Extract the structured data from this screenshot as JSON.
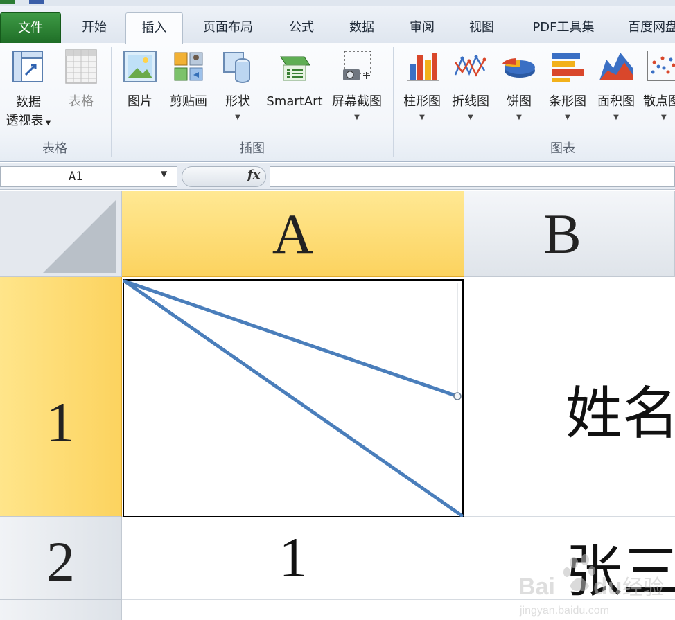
{
  "ribbon_tabs": [
    {
      "label": "文件"
    },
    {
      "label": "开始"
    },
    {
      "label": "插入"
    },
    {
      "label": "页面布局"
    },
    {
      "label": "公式"
    },
    {
      "label": "数据"
    },
    {
      "label": "审阅"
    },
    {
      "label": "视图"
    },
    {
      "label": "PDF工具集"
    },
    {
      "label": "百度网盘"
    }
  ],
  "active_tab": "插入",
  "groups": {
    "tables": {
      "label": "表格",
      "buttons": [
        {
          "label_line1": "数据",
          "label_line2": "透视表",
          "icon": "pivot-table-icon"
        },
        {
          "label": "表格",
          "icon": "table-icon",
          "disabled": true
        }
      ]
    },
    "illustrations": {
      "label": "插图",
      "buttons": [
        {
          "label": "图片",
          "icon": "picture-icon"
        },
        {
          "label": "剪贴画",
          "icon": "clipart-icon"
        },
        {
          "label": "形状",
          "icon": "shapes-icon"
        },
        {
          "label": "SmartArt",
          "icon": "smartart-icon"
        },
        {
          "label": "屏幕截图",
          "icon": "screenshot-icon"
        }
      ]
    },
    "charts": {
      "label": "图表",
      "buttons": [
        {
          "label": "柱形图",
          "icon": "column-chart-icon"
        },
        {
          "label": "折线图",
          "icon": "line-chart-icon"
        },
        {
          "label": "饼图",
          "icon": "pie-chart-icon"
        },
        {
          "label": "条形图",
          "icon": "bar-chart-icon"
        },
        {
          "label": "面积图",
          "icon": "area-chart-icon"
        },
        {
          "label": "散点图",
          "icon": "scatter-chart-icon"
        }
      ]
    }
  },
  "formula_bar": {
    "name_box": "A1",
    "fx_label": "fx",
    "formula": ""
  },
  "sheet": {
    "columns": [
      "A",
      "B"
    ],
    "rows": [
      "1",
      "2"
    ],
    "cells": {
      "B1": "姓名",
      "A2": "1",
      "B2": "张三"
    },
    "selected_cell": "A1"
  },
  "watermark": {
    "text": "Baidu经验",
    "subtext": "jingyan.baidu.com"
  },
  "colors": {
    "file_tab": "#2a7d32",
    "selected_header": "#fcd35f",
    "diagonal_line": "#4a7ebb"
  }
}
